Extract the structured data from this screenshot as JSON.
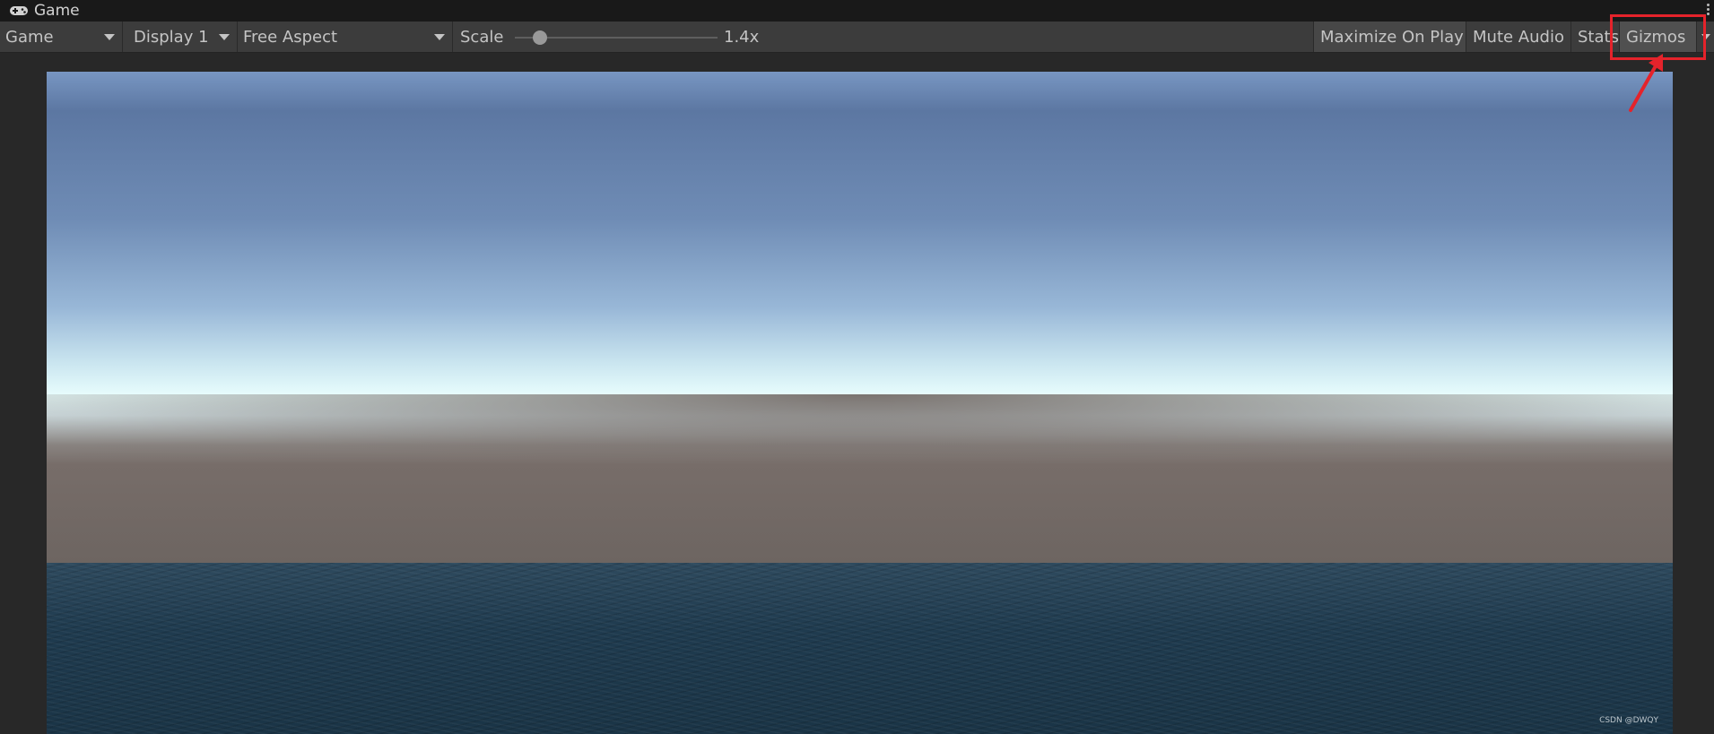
{
  "window": {
    "tab_title": "Game",
    "tab_icon": "gamepad-icon"
  },
  "toolbar": {
    "view_mode": "Game",
    "display": "Display 1",
    "aspect": "Free Aspect",
    "scale_label": "Scale",
    "scale_value": "1.4x",
    "maximize_on_play": "Maximize On Play",
    "mute_audio": "Mute Audio",
    "stats": "Stats",
    "gizmos": "Gizmos"
  },
  "viewport": {
    "watermark": "CSDN @DWQY"
  },
  "colors": {
    "toolbar_bg": "#3c3c3c",
    "highlight": "#e5232b"
  }
}
